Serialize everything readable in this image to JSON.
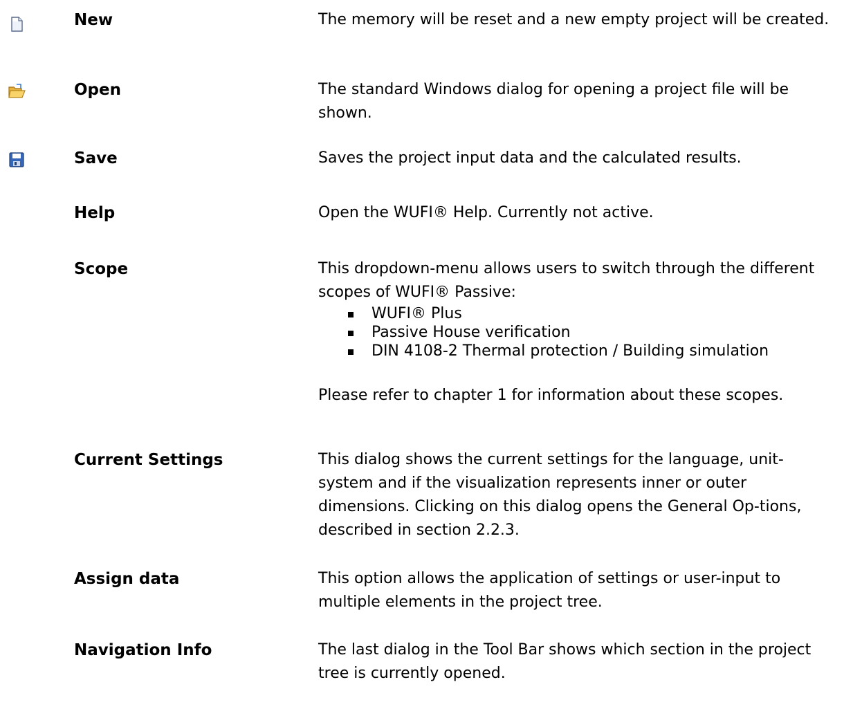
{
  "entries": [
    {
      "term": "New",
      "icon": "new-document-icon",
      "description": "The memory will be reset and a new empty project will be created."
    },
    {
      "term": "Open",
      "icon": "open-folder-icon",
      "description": "The standard Windows dialog for opening a project file will be shown."
    },
    {
      "term": "Save",
      "icon": "save-disk-icon",
      "description": "Saves the project input data and the calculated results."
    },
    {
      "term": "Help",
      "description": "Open the WUFI® Help. Currently not active."
    },
    {
      "term": "Scope",
      "description": "This dropdown-menu allows users to switch through the different scopes  of WUFI® Passive:",
      "bullets": [
        "WUFI® Plus",
        "Passive House verification",
        "DIN 4108-2 Thermal protection / Building simulation"
      ],
      "note": "Please refer to chapter 1 for information about these scopes."
    },
    {
      "term": "Current Settings",
      "description": "This dialog shows the current settings for the language, unit-system and if the visualization represents inner or outer dimensions. Clicking on this dialog opens the General Op-tions, described in section 2.2.3."
    },
    {
      "term": "Assign data",
      "description": "This option allows the application of settings or user-input to multiple elements in the project tree."
    },
    {
      "term": "Navigation Info",
      "description": "The last dialog in the Tool Bar shows which section in the project tree is currently opened."
    }
  ]
}
